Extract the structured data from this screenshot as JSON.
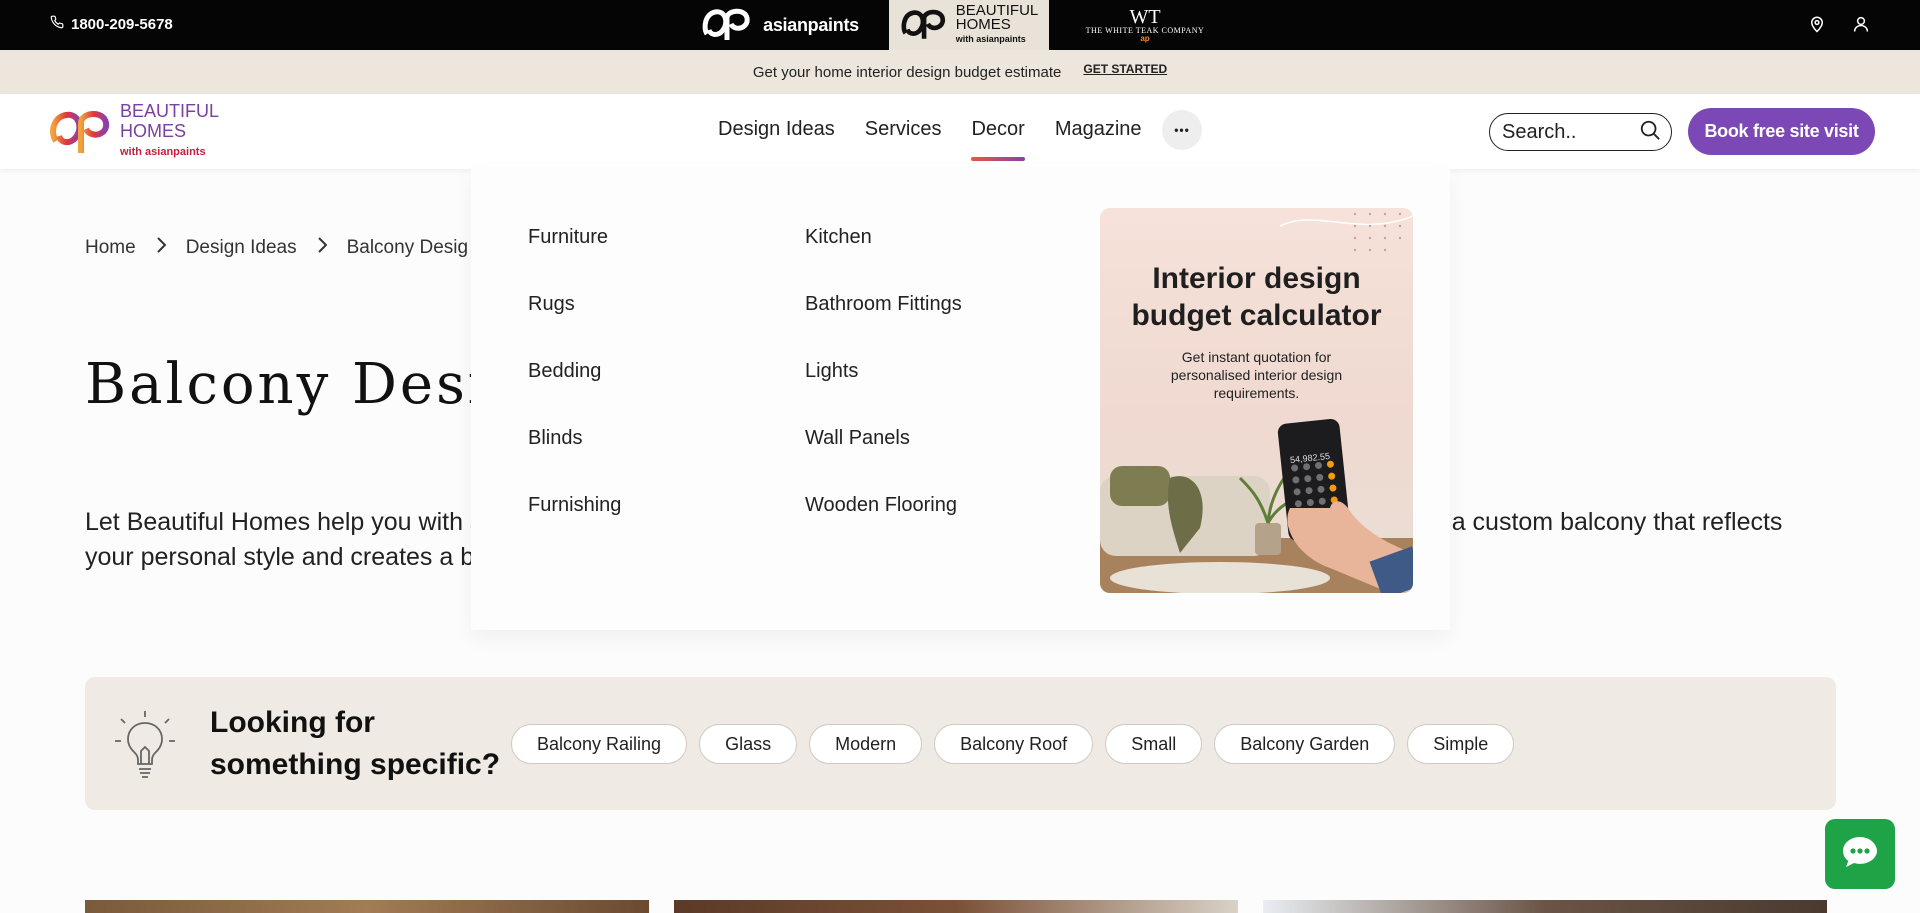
{
  "topbar": {
    "phone": "1800-209-5678",
    "brands": {
      "asianpaints": "asianpaints",
      "beautiful_homes_line1": "BEAUTIFUL",
      "beautiful_homes_line2": "HOMES",
      "beautiful_homes_sub": "with asianpaints",
      "white_teak_mark": "WT",
      "white_teak_name": "THE WHITE TEAK COMPANY",
      "white_teak_sub": "ap"
    },
    "icons": [
      "phone-icon",
      "location-icon",
      "user-icon"
    ]
  },
  "announcement": {
    "text": "Get your home interior design budget estimate",
    "cta": "GET STARTED"
  },
  "header": {
    "logo_line1": "BEAUTIFUL",
    "logo_line2": "HOMES",
    "logo_sub": "with asianpaints",
    "nav": [
      "Design Ideas",
      "Services",
      "Decor",
      "Magazine"
    ],
    "active_nav": "Decor",
    "more": "•••",
    "search_placeholder": "Search..",
    "book_button": "Book free site visit"
  },
  "breadcrumb": [
    "Home",
    "Design Ideas",
    "Balcony Desig"
  ],
  "page": {
    "title": "Balcony Desi",
    "desc_left_line1": "Let Beautiful Homes help you with s",
    "desc_left_line2": "your personal style and creates a be",
    "desc_right_line1": "ate a custom balcony that reflects"
  },
  "looking": {
    "title_line1": "Looking for",
    "title_line2": "something specific?",
    "chips": [
      "Balcony Railing",
      "Glass",
      "Modern",
      "Balcony Roof",
      "Small",
      "Balcony Garden",
      "Simple"
    ]
  },
  "mega_menu": {
    "col1": [
      "Furniture",
      "Rugs",
      "Bedding",
      "Blinds",
      "Furnishing"
    ],
    "col2": [
      "Kitchen",
      "Bathroom Fittings",
      "Lights",
      "Wall Panels",
      "Wooden Flooring"
    ],
    "promo": {
      "title_line1": "Interior design",
      "title_line2": "budget calculator",
      "subtitle": "Get instant quotation for personalised interior design requirements.",
      "phone_display": "54,982.55"
    }
  },
  "colors": {
    "accent_purple": "#7b48b5",
    "chat_green": "#1fa347",
    "topbar": "#050505",
    "announce_bg": "#ece6dc",
    "lookbar_bg": "#efebe4"
  }
}
